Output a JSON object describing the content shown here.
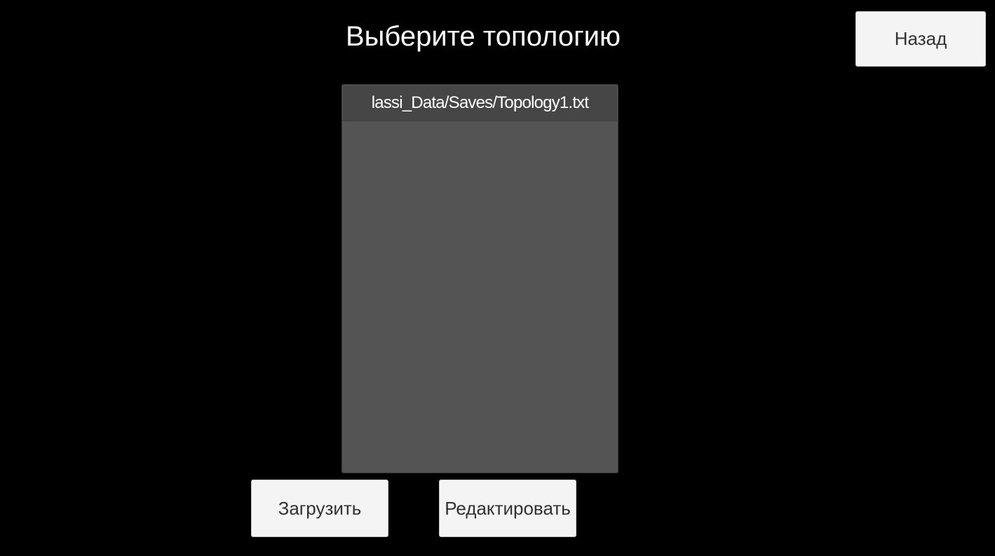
{
  "header": {
    "title": "Выберите топологию"
  },
  "buttons": {
    "back_label": "Назад",
    "load_label": "Загрузить",
    "edit_label": "Редактировать"
  },
  "topology_list": {
    "items": [
      {
        "label": "lassi_Data/Saves/Topology1.txt"
      }
    ]
  },
  "colors": {
    "background": "#000000",
    "panel": "#545454",
    "list_item": "#464646",
    "button": "#f4f4f4",
    "button_text": "#323232",
    "title_text": "#ffffff"
  }
}
